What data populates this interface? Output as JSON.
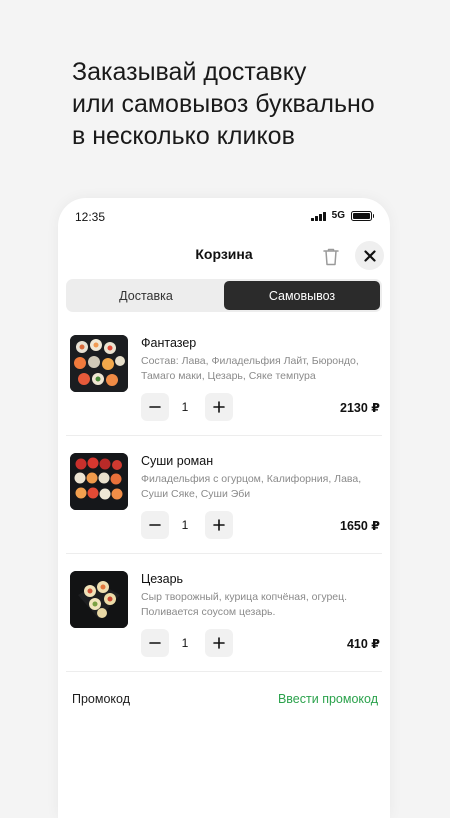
{
  "headline": {
    "line1": "Заказывай доставку",
    "line2": "или самовывоз буквально",
    "line3": "в несколько кликов"
  },
  "status_bar": {
    "time": "12:35",
    "network": "5G"
  },
  "header": {
    "title": "Корзина",
    "trash_icon": "trash-icon",
    "close_icon": "close-icon"
  },
  "delivery_tabs": [
    {
      "label": "Доставка",
      "active": false
    },
    {
      "label": "Самовывоз",
      "active": true
    }
  ],
  "cart_items": [
    {
      "name": "Фантазер",
      "description": "Состав: Лава, Филадельфия Лайт, Бюрондо, Тамаго маки, Цезарь, Сяке темпура",
      "quantity": "1",
      "price": "2130 ₽"
    },
    {
      "name": "Суши роман",
      "description": "Филадельфия с огурцом, Калифорния, Лава, Суши Сяке, Суши Эби",
      "quantity": "1",
      "price": "1650 ₽"
    },
    {
      "name": "Цезарь",
      "description": "Сыр творожный, курица копчёная, огурец. Поливается соусом цезарь.",
      "quantity": "1",
      "price": "410 ₽"
    }
  ],
  "promo": {
    "label": "Промокод",
    "action": "Ввести промокод"
  },
  "colors": {
    "accent_green": "#2ba24c",
    "active_tab": "#2b2b2b"
  }
}
